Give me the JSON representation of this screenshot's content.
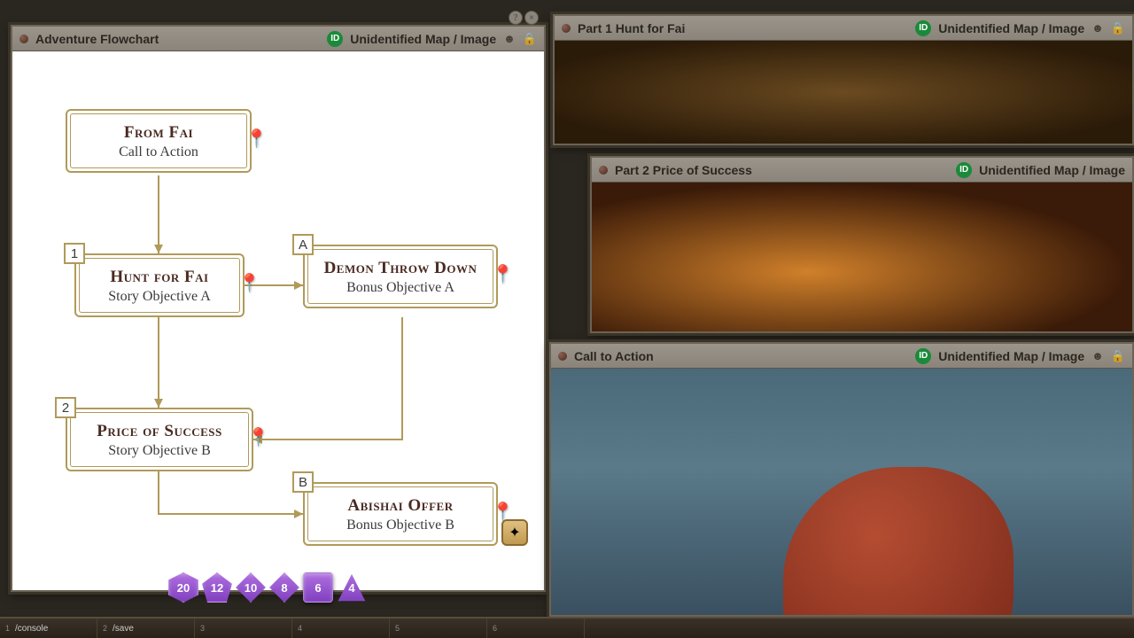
{
  "windows": {
    "flowchart": {
      "title": "Adventure Flowchart",
      "status": "Unidentified Map / Image"
    },
    "part1": {
      "title": "Part 1 Hunt for Fai",
      "status": "Unidentified Map / Image"
    },
    "part2": {
      "title": "Part 2 Price of Success",
      "status": "Unidentified Map / Image"
    },
    "call": {
      "title": "Call to Action",
      "status": "Unidentified Map / Image"
    }
  },
  "id_label": "ID",
  "nodes": {
    "from_fai": {
      "header": "From Fai",
      "sub": "Call to Action"
    },
    "hunt": {
      "header": "Hunt for Fai",
      "sub": "Story Objective A",
      "tag": "1"
    },
    "demon": {
      "header": "Demon Throw Down",
      "sub": "Bonus Objective A",
      "tag": "A"
    },
    "price": {
      "header": "Price of Success",
      "sub": "Story Objective B",
      "tag": "2"
    },
    "abishai": {
      "header": "Abishai Offer",
      "sub": "Bonus Objective B",
      "tag": "B"
    }
  },
  "dice": [
    "20",
    "12",
    "10",
    "8",
    "6",
    "4"
  ],
  "hotbar": [
    {
      "n": "1",
      "label": "/console"
    },
    {
      "n": "2",
      "label": "/save"
    },
    {
      "n": "3",
      "label": ""
    },
    {
      "n": "4",
      "label": ""
    },
    {
      "n": "5",
      "label": ""
    },
    {
      "n": "6",
      "label": ""
    }
  ]
}
